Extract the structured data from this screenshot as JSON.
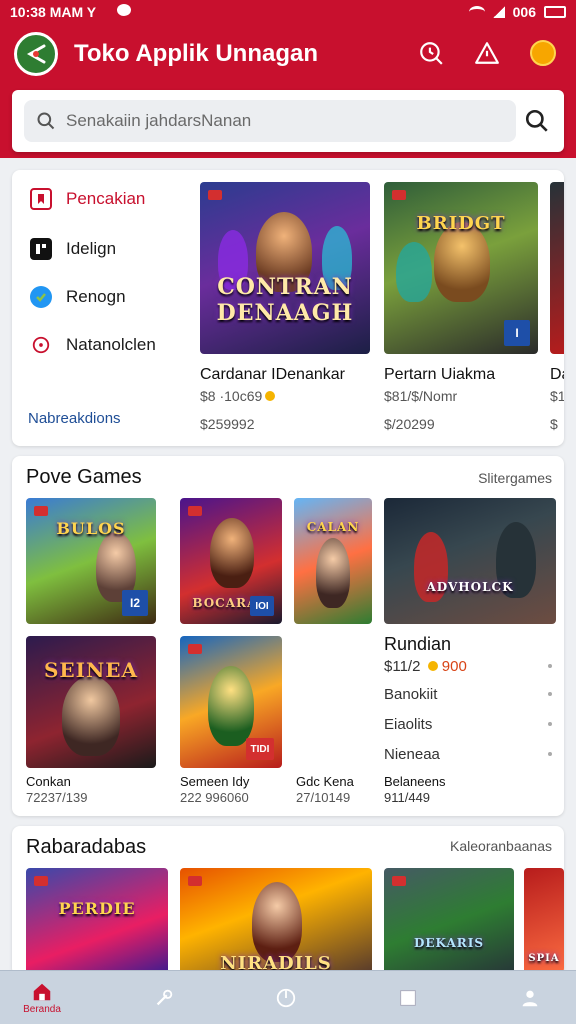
{
  "status_bar": {
    "time": "10:38 MAM Y",
    "right_text": "006"
  },
  "app": {
    "title": "Toko Applik Unnagan"
  },
  "search": {
    "placeholder": "Senakaiin jahdarsNanan"
  },
  "categories": [
    {
      "label": "Pencakian",
      "icon": "bookmark-icon"
    },
    {
      "label": "Idelign",
      "icon": "grid-icon"
    },
    {
      "label": "Renogn",
      "icon": "check-icon"
    },
    {
      "label": "Natanolclen",
      "icon": "circle-icon"
    }
  ],
  "recs_link": "Nabreakdions",
  "featured": [
    {
      "art_text": "CONTRAN DENAAGH",
      "name": "Cardanar IDenankar",
      "sub": "$8 ·10c69",
      "price": "$259992"
    },
    {
      "art_text": "BRIDGT",
      "name": "Pertarn Uiakma",
      "sub": "$81/$/Nomr",
      "price": "$/20299",
      "badge": "I"
    },
    {
      "name": "Da",
      "sub": "$1",
      "price": "$"
    }
  ],
  "popular": {
    "title": "Pove Games",
    "link": "Slitergames",
    "tiles": [
      {
        "art_text": "BULOS",
        "corner": "I2"
      },
      {
        "art_text": "BOCARAH",
        "corner": "IOI"
      },
      {
        "art_text": "CALAN"
      },
      {
        "art_text": "ADVHOLCK"
      },
      {
        "art_text": "SEINEA",
        "name": "Conkan",
        "price": "72237/139"
      },
      {
        "art_text": "TIDI",
        "name": "Semeen Idy",
        "price": "222 996060"
      },
      {
        "name": "Gdc Kena",
        "price": "27/10149"
      }
    ],
    "side": {
      "title": "Rundian",
      "price": "$11/2",
      "price_hl": "900",
      "rows": [
        "Banokiit",
        "Eiaolits",
        "Nieneaa"
      ],
      "name": "Belaneens",
      "sub": "911/449"
    }
  },
  "rewards": {
    "title": "Rabaradabas",
    "link": "Kaleoranbaanas",
    "tiles": [
      {
        "art_text": "PERDIE"
      },
      {
        "art_text": "NIRADILS"
      },
      {
        "art_text": "DEKARIS"
      },
      {
        "art_text": "SPIA"
      }
    ]
  },
  "bottom_nav": [
    {
      "label": "Beranda",
      "icon": "home-icon"
    },
    {
      "label": "",
      "icon": "magic-wand-icon"
    },
    {
      "label": "",
      "icon": "power-icon"
    },
    {
      "label": "",
      "icon": "square-icon"
    },
    {
      "label": "",
      "icon": "profile-icon"
    }
  ],
  "colors": {
    "brand": "#c8102e",
    "link": "#1f4e96",
    "bottom_nav": "#c9d3df"
  }
}
